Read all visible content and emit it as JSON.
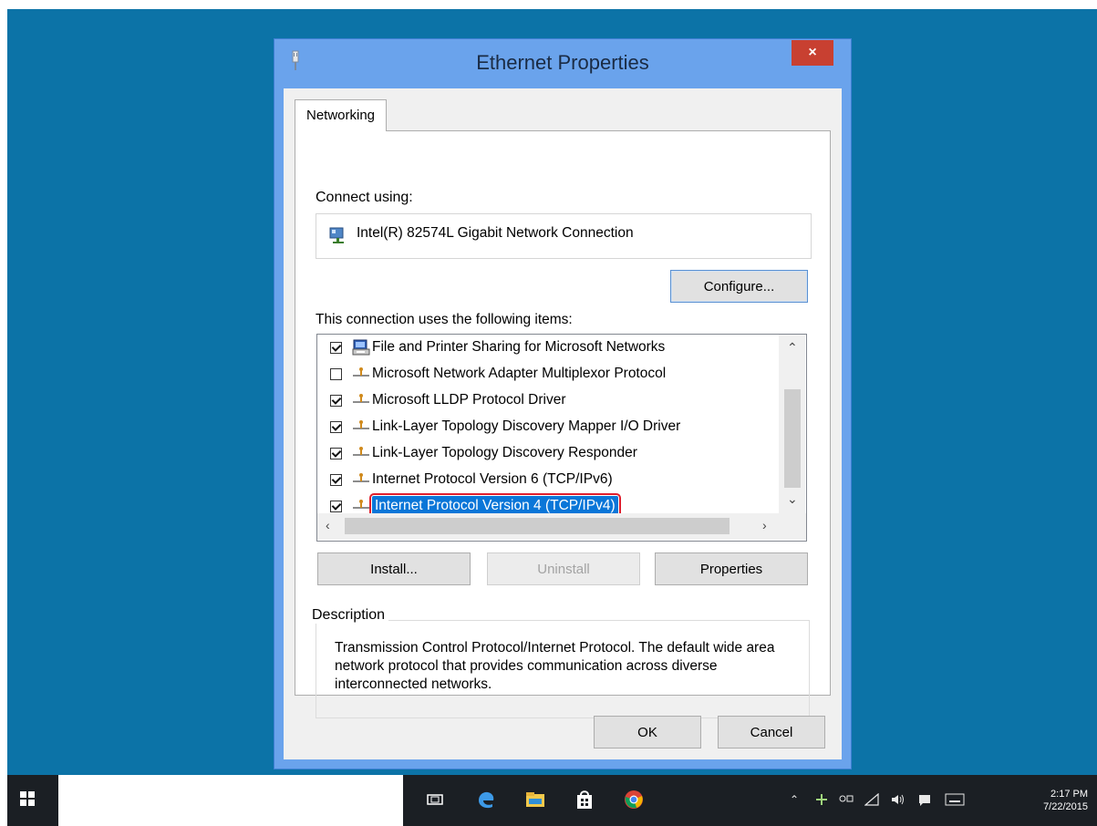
{
  "dialog": {
    "title": "Ethernet Properties",
    "close_glyph": "×",
    "tab": "Networking",
    "connect_using_label": "Connect using:",
    "adapter_name": "Intel(R) 82574L Gigabit Network Connection",
    "configure_label": "Configure...",
    "items_label": "This connection uses the following items:",
    "items": [
      {
        "label": "File and Printer Sharing for Microsoft Networks",
        "checked": true,
        "icon": "file-printer-sharing-icon"
      },
      {
        "label": "Microsoft Network Adapter Multiplexor Protocol",
        "checked": false,
        "icon": "protocol-icon"
      },
      {
        "label": "Microsoft LLDP Protocol Driver",
        "checked": true,
        "icon": "protocol-icon"
      },
      {
        "label": "Link-Layer Topology Discovery Mapper I/O Driver",
        "checked": true,
        "icon": "protocol-icon"
      },
      {
        "label": "Link-Layer Topology Discovery Responder",
        "checked": true,
        "icon": "protocol-icon"
      },
      {
        "label": "Internet Protocol Version 6 (TCP/IPv6)",
        "checked": true,
        "icon": "protocol-icon"
      },
      {
        "label": "Internet Protocol Version 4 (TCP/IPv4)",
        "checked": true,
        "icon": "protocol-icon",
        "selected": true
      }
    ],
    "install_label": "Install...",
    "uninstall_label": "Uninstall",
    "properties_label": "Properties",
    "description_legend": "Description",
    "description_text": "Transmission Control Protocol/Internet Protocol. The default wide area network protocol that provides communication across diverse interconnected networks.",
    "ok_label": "OK",
    "cancel_label": "Cancel"
  },
  "taskbar": {
    "time": "2:17 PM",
    "date": "7/22/2015",
    "apps": [
      "task-view-icon",
      "edge-icon",
      "file-explorer-icon",
      "store-icon",
      "chrome-icon"
    ],
    "tray": [
      "chevron-up-icon",
      "network-tray-icon",
      "input-indicator-icon",
      "wifi-icon",
      "volume-icon",
      "action-center-icon",
      "keyboard-icon"
    ]
  },
  "colors": {
    "desktop": "#0c73a7",
    "dialog_frame": "#6aa3ec",
    "close_button": "#c84031",
    "selection": "#0a76d8",
    "highlight_outline": "#e01e2c"
  }
}
